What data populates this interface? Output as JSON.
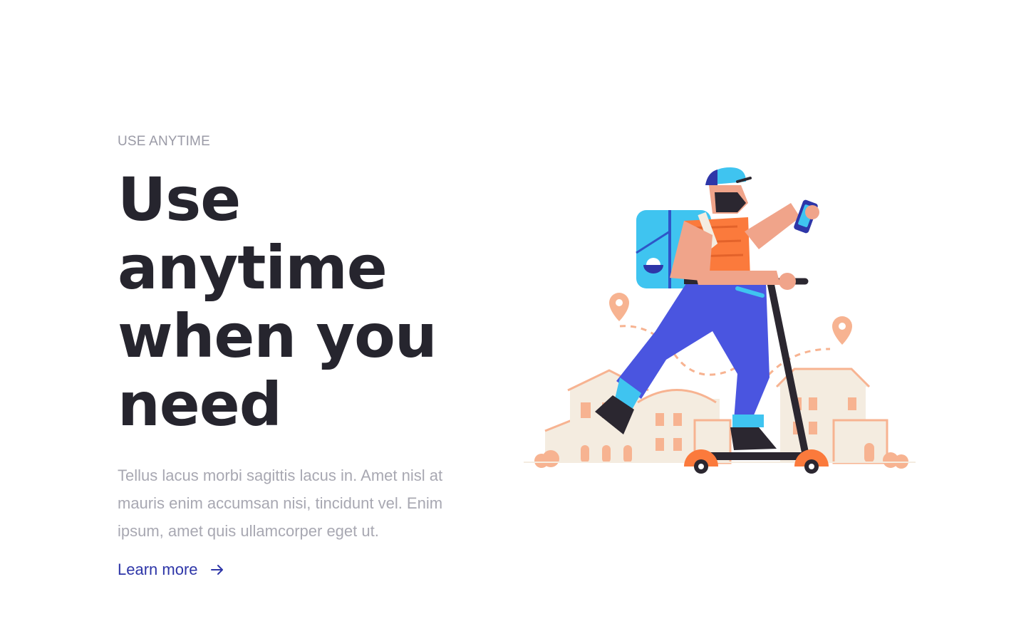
{
  "section": {
    "eyebrow": "USE ANYTIME",
    "headline": "Use anytime when you need",
    "body": "Tellus lacus morbi sagittis lacus in. Amet nisl at mauris enim accumsan nisi, tincidunt vel. Enim ipsum, amet quis ullamcorper eget ut.",
    "cta_label": "Learn more",
    "cta_icon": "arrow-right-icon"
  },
  "illustration": {
    "subject": "delivery-courier-on-scooter"
  },
  "colors": {
    "heading": "#26252e",
    "muted": "#a8a8b2",
    "link": "#2e36a8",
    "accent_orange": "#fb7a3c",
    "accent_blue": "#3fc4f0",
    "pants_blue": "#4a55e0",
    "building_beige": "#f4ece0",
    "building_peach": "#f7b391"
  }
}
